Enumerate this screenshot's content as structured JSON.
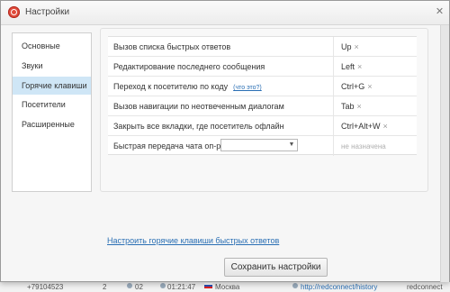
{
  "window": {
    "title": "Настройки"
  },
  "sidebar": {
    "items": [
      {
        "label": "Основные",
        "active": false
      },
      {
        "label": "Звуки",
        "active": false
      },
      {
        "label": "Горячие клавиши",
        "active": true
      },
      {
        "label": "Посетители",
        "active": false
      },
      {
        "label": "Расширенные",
        "active": false
      }
    ]
  },
  "hotkeys": {
    "rows": [
      {
        "action": "Вызов списка быстрых ответов",
        "key": "Up"
      },
      {
        "action": "Редактирование последнего сообщения",
        "key": "Left"
      },
      {
        "action": "Переход к посетителю по коду",
        "link": "(что это?)",
        "key": "Ctrl+G"
      },
      {
        "action": "Вызов навигации по неотвеченным диалогам",
        "key": "Tab"
      },
      {
        "action": "Закрыть все вкладки, где посетитель офлайн",
        "key": "Ctrl+Alt+W"
      },
      {
        "action": "Быстрая передача чата оп-ру",
        "select_value": "",
        "key_placeholder": "не назначена"
      }
    ],
    "remove_glyph": "×"
  },
  "footer": {
    "configure_link": "Настроить горячие клавиши быстрых ответов",
    "save_label": "Сохранить настройки"
  },
  "background": {
    "items": [
      "+79104523",
      "2",
      "02",
      "01:21:47",
      "Москва",
      "http://redconnect/history",
      "redconnect"
    ]
  },
  "colors": {
    "accent": "#e04a3a",
    "active_nav": "#cfe6f6",
    "link": "#2a6fb4"
  }
}
